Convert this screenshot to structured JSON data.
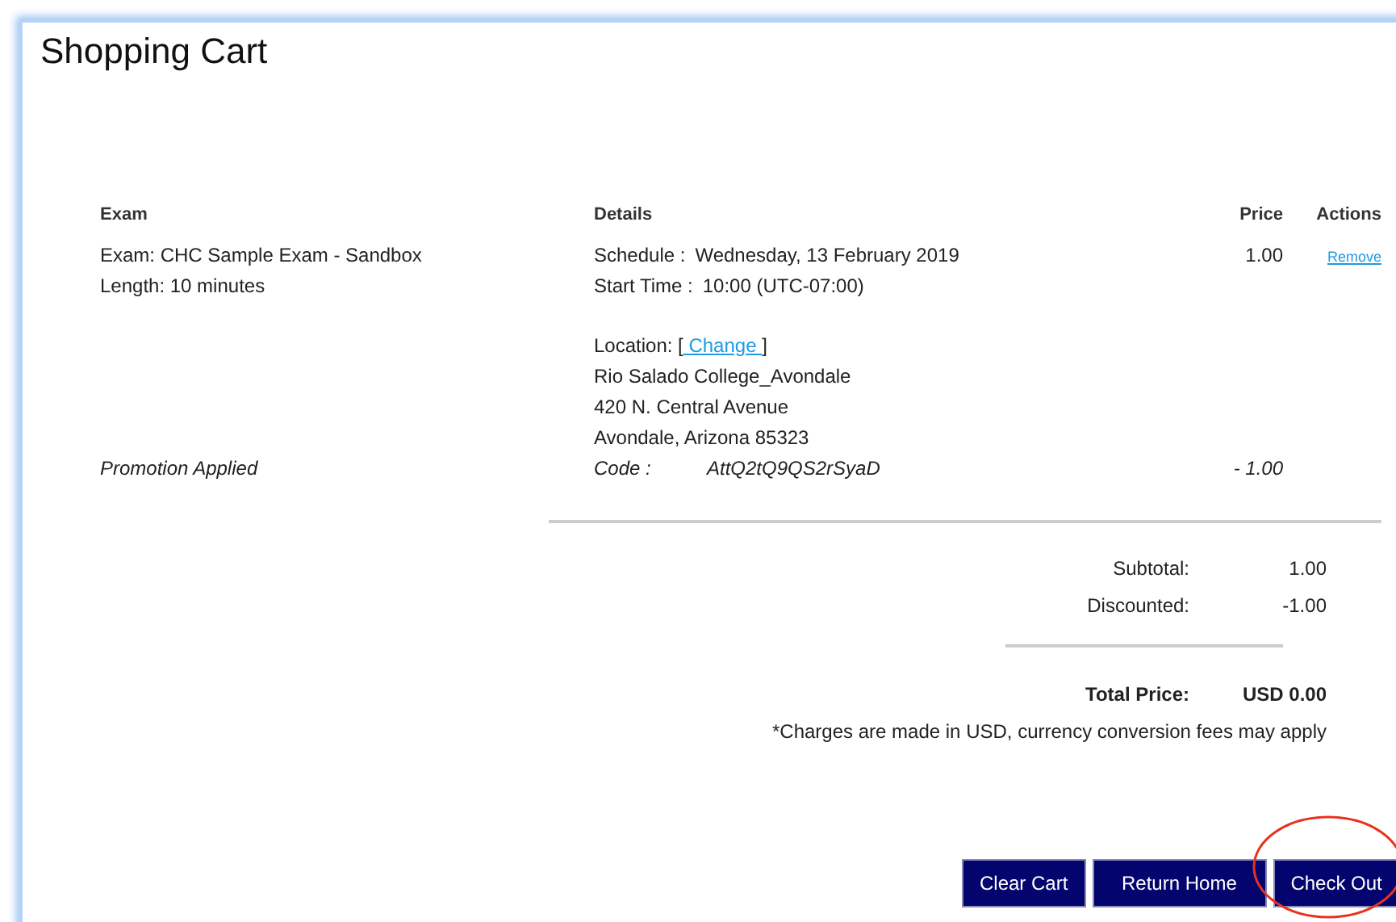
{
  "title": "Shopping Cart",
  "table": {
    "columns": [
      "Exam",
      "Details",
      "Price",
      "Actions"
    ],
    "item": {
      "exam": [
        "Exam: CHC Sample Exam - Sandbox",
        "Length: 10 minutes"
      ],
      "schedule_label": "Schedule :",
      "schedule": "Wednesday, 13 February 2019",
      "start_label": "Start Time :",
      "start_time": "10:00 (UTC-07:00)",
      "location_open": "Location: [",
      "location_link": "Change",
      "location_close": "]",
      "location_lines": [
        "Rio Salado College_Avondale",
        "420 N. Central Avenue",
        "Avondale, Arizona 85323"
      ],
      "price": "1.00",
      "action": "Remove"
    },
    "promotion": {
      "label": "Promotion Applied",
      "code_label": "Code :",
      "code": "AttQ2tQ9QS2rSyaD",
      "amount": "- 1.00"
    }
  },
  "summary": [
    {
      "label": "Subtotal:",
      "value": "1.00"
    },
    {
      "label": "Discounted:",
      "value": "-1.00"
    }
  ],
  "total": {
    "label": "Total Price:",
    "value": "USD 0.00"
  },
  "note": "*Charges are made in USD, currency conversion fees may apply",
  "buttons": [
    {
      "label": "Clear Cart",
      "highlighted": false
    },
    {
      "label": "Return Home",
      "highlighted": false
    },
    {
      "label": "Check Out",
      "highlighted": true
    }
  ]
}
